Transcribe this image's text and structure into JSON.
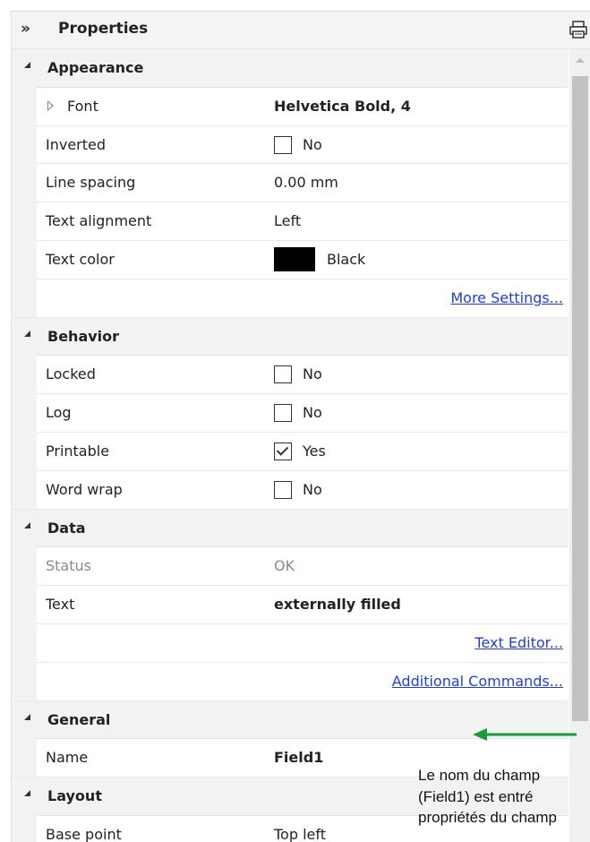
{
  "panel": {
    "title": "Properties",
    "collapse_icon": "»",
    "print_icon": "printer-icon"
  },
  "sections": {
    "appearance": {
      "label": "Appearance",
      "font": {
        "name": "Font",
        "value": "Helvetica Bold, 4"
      },
      "inverted": {
        "name": "Inverted",
        "value": "No",
        "checked": false
      },
      "line_spacing": {
        "name": "Line spacing",
        "value": "0.00 mm"
      },
      "text_alignment": {
        "name": "Text alignment",
        "value": "Left"
      },
      "text_color": {
        "name": "Text color",
        "value": "Black",
        "color": "#000000"
      },
      "more_settings": "More Settings..."
    },
    "behavior": {
      "label": "Behavior",
      "locked": {
        "name": "Locked",
        "value": "No",
        "checked": false
      },
      "log": {
        "name": "Log",
        "value": "No",
        "checked": false
      },
      "printable": {
        "name": "Printable",
        "value": "Yes",
        "checked": true
      },
      "word_wrap": {
        "name": "Word wrap",
        "value": "No",
        "checked": false
      }
    },
    "data": {
      "label": "Data",
      "status": {
        "name": "Status",
        "value": "OK"
      },
      "text": {
        "name": "Text",
        "value": "externally filled"
      },
      "text_editor": "Text Editor...",
      "additional_commands": "Additional Commands..."
    },
    "general": {
      "label": "General",
      "name": {
        "name": "Name",
        "value": "Field1"
      }
    },
    "layout": {
      "label": "Layout",
      "base_point": {
        "name": "Base point",
        "value": "Top left"
      }
    }
  },
  "annotation": {
    "lines": [
      "Le nom du champ",
      "(Field1) est entré",
      "propriétés du champ"
    ],
    "arrow_color": "#1a9a3a"
  },
  "colors": {
    "link": "#1f3fd8",
    "section_bg": "#f2f2f2"
  }
}
